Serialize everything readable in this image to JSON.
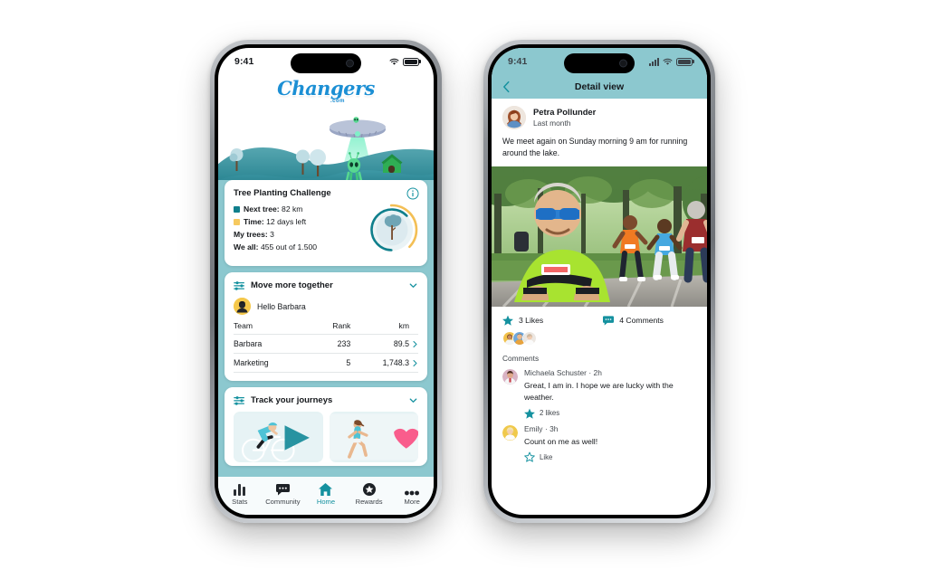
{
  "left_phone": {
    "status_bar": {
      "time": "9:41",
      "wifi": "wifi-icon",
      "battery": "battery-icon"
    },
    "brand": {
      "name": "Changers",
      "suffix": ".com"
    },
    "hero": {
      "alt": "alien-ufo-landscape-illustration"
    },
    "tree_card": {
      "title": "Tree Planting Challenge",
      "info_icon": "info-icon",
      "lines": [
        {
          "label": "Next tree:",
          "value": "82 km",
          "swatch": "teal"
        },
        {
          "label": "Time:",
          "value": "12 days left",
          "swatch": "gold"
        },
        {
          "label": "My trees:",
          "value": "3",
          "swatch": "none"
        },
        {
          "label": "We all:",
          "value": "455 out of 1.500",
          "swatch": "none"
        }
      ],
      "ring": {
        "teal_pct": 62,
        "gold_pct": 38,
        "teal_color": "#0f7f8c",
        "gold_color": "#f3bf55"
      }
    },
    "move_card": {
      "title": "Move more together",
      "icon": "sliders-icon",
      "chevron": "chevron-down-icon",
      "greeting": "Hello Barbara",
      "columns": [
        "Team",
        "Rank",
        "km"
      ],
      "rows": [
        {
          "team": "Barbara",
          "rank": "233",
          "km": "89.5"
        },
        {
          "team": "Marketing",
          "rank": "5",
          "km": "1,748.3"
        }
      ]
    },
    "journeys_card": {
      "title": "Track your journeys",
      "icon": "sliders-icon",
      "chevron": "chevron-down-icon",
      "tiles": [
        {
          "alt": "cyclist-illustration",
          "overlay": "play-icon"
        },
        {
          "alt": "runner-illustration",
          "overlay": "heart-icon"
        }
      ]
    },
    "tabbar": [
      {
        "label": "Stats",
        "icon": "bar-chart-icon",
        "active": false
      },
      {
        "label": "Community",
        "icon": "chat-bubble-icon",
        "active": false
      },
      {
        "label": "Home",
        "icon": "home-icon",
        "active": true
      },
      {
        "label": "Rewards",
        "icon": "star-badge-icon",
        "active": false
      },
      {
        "label": "More",
        "icon": "ellipsis-icon",
        "active": false
      }
    ],
    "accent_color": "#14919f",
    "header_color": "#8cc8cf"
  },
  "right_phone": {
    "status_bar": {
      "time": "9:41",
      "signal": "signal-bars-icon",
      "wifi": "wifi-icon",
      "battery": "battery-icon"
    },
    "header": {
      "title": "Detail view",
      "back_icon": "back-chevron-icon"
    },
    "post": {
      "author": "Petra Pollunder",
      "timestamp": "Last month",
      "avatar": "avatar-petra",
      "text": "We meet again on Sunday morning 9 am for running around the lake.",
      "photo_alt": "runners-on-park-path-photo"
    },
    "engagement": {
      "likes_label": "3 Likes",
      "likes_icon": "star-filled-icon",
      "comments_label": "4 Comments",
      "comments_icon": "comment-bubble-icon",
      "liker_avatars": [
        "avatar-liker-1",
        "avatar-liker-2",
        "avatar-liker-3"
      ]
    },
    "comments_heading": "Comments",
    "comments": [
      {
        "author": "Michaela Schuster",
        "time": "2h",
        "separator": "·",
        "text": "Great, I am in. I hope we are lucky with the weather.",
        "action_label": "2 likes",
        "action_icon": "star-filled-icon",
        "avatar": "avatar-michaela"
      },
      {
        "author": "Emily",
        "time": "3h",
        "separator": "·",
        "text": "Count on me as well!",
        "action_label": "Like",
        "action_icon": "star-outline-icon",
        "avatar": "avatar-emily"
      }
    ],
    "accent_color": "#14919f",
    "header_color": "#8cc8cf"
  }
}
